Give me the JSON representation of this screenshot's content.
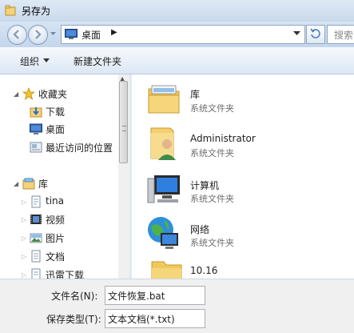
{
  "window": {
    "title": "另存为"
  },
  "address": {
    "location": "桌面",
    "search_placeholder": "搜索"
  },
  "toolbar": {
    "organize": "组织",
    "new_folder": "新建文件夹"
  },
  "nav": {
    "favorites": "收藏夹",
    "downloads": "下载",
    "desktop": "桌面",
    "recent": "最近访问的位置",
    "libraries": "库",
    "tina": "tina",
    "videos": "视频",
    "pictures": "图片",
    "documents": "文档",
    "thunder": "迅雷下载"
  },
  "files": [
    {
      "name": "库",
      "type": "系统文件夹",
      "icon": "library-folder-icon"
    },
    {
      "name": "Administrator",
      "type": "系统文件夹",
      "icon": "user-folder-icon"
    },
    {
      "name": "计算机",
      "type": "系统文件夹",
      "icon": "computer-icon"
    },
    {
      "name": "网络",
      "type": "系统文件夹",
      "icon": "network-icon"
    },
    {
      "name": "10.16",
      "type": "",
      "icon": "folder-icon"
    }
  ],
  "fields": {
    "filename_label": "文件名(N):",
    "filename_value": "文件恢复.bat",
    "filetype_label": "保存类型(T):",
    "filetype_value": "文本文档(*.txt)"
  }
}
